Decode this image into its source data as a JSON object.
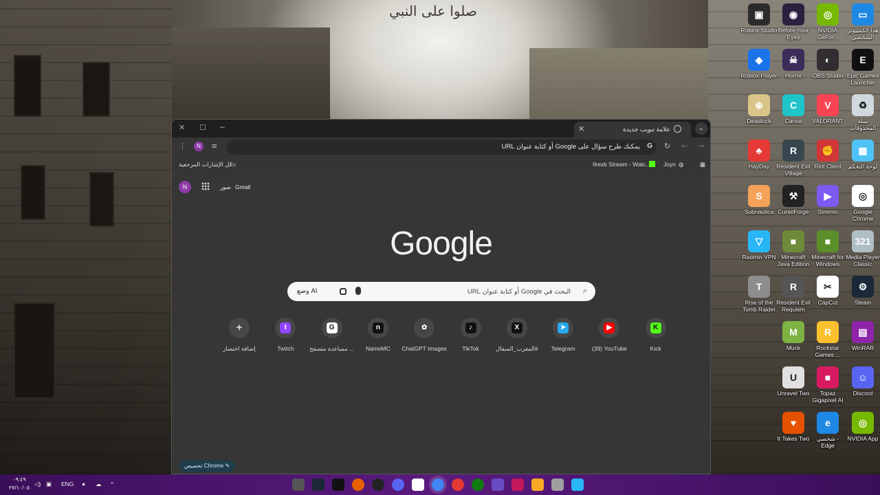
{
  "wallpaper": {
    "title": "صلوا على النبي"
  },
  "desktop_icons": [
    {
      "label": "Roblox Studio",
      "color": "#2b2b2b",
      "glyph": "▣"
    },
    {
      "label": "Before Your Eyes",
      "color": "#2a2140",
      "glyph": "◉"
    },
    {
      "label": "NVIDIA GeFor...",
      "color": "#76b900",
      "glyph": "◎"
    },
    {
      "label": "هذا الكمبيوتر الشخصي",
      "color": "#1e88e5",
      "glyph": "▭"
    },
    {
      "label": "Roblox Player",
      "color": "#1a73e8",
      "glyph": "◆"
    },
    {
      "label": "Horror",
      "color": "#3b2c5a",
      "glyph": "☠"
    },
    {
      "label": "OBS Studio",
      "color": "#302e31",
      "glyph": "◐"
    },
    {
      "label": "Epic Games Launcher",
      "color": "#111111",
      "glyph": "E"
    },
    {
      "label": "Deadlock",
      "color": "#d9c58a",
      "glyph": "⊕"
    },
    {
      "label": "Canva",
      "color": "#20c4cb",
      "glyph": "C"
    },
    {
      "label": "VALORANT",
      "color": "#fa4454",
      "glyph": "V"
    },
    {
      "label": "سلة المحذوفات",
      "color": "#cfd8dc",
      "glyph": "♻"
    },
    {
      "label": "HayDay",
      "color": "#e53935",
      "glyph": "♣"
    },
    {
      "label": "Resident Evil Village",
      "color": "#37474f",
      "glyph": "R"
    },
    {
      "label": "Riot Client",
      "color": "#d13639",
      "glyph": "✊"
    },
    {
      "label": "لوحة التحكم",
      "color": "#4fc3f7",
      "glyph": "▦"
    },
    {
      "label": "Subnautica",
      "color": "#f4a259",
      "glyph": "S"
    },
    {
      "label": "CurseForge",
      "color": "#222222",
      "glyph": "⚒"
    },
    {
      "label": "Stremio",
      "color": "#7b5bf2",
      "glyph": "▶"
    },
    {
      "label": "Google Chrome",
      "color": "#ffffff",
      "glyph": "◎"
    },
    {
      "label": "Radmin VPN",
      "color": "#29b6f6",
      "glyph": "▽"
    },
    {
      "label": "Minecraft Java Edition",
      "color": "#6d8b3a",
      "glyph": "■"
    },
    {
      "label": "Minecraft for Windows",
      "color": "#5a8f29",
      "glyph": "■"
    },
    {
      "label": "Media Player Classic",
      "color": "#b0bec5",
      "glyph": "321"
    },
    {
      "label": "Rise of the Tomb Raider",
      "color": "#8d8d8d",
      "glyph": "T"
    },
    {
      "label": "Resident Evil Requiem",
      "color": "#555555",
      "glyph": "R"
    },
    {
      "label": "CapCut",
      "color": "#ffffff",
      "glyph": "✂"
    },
    {
      "label": "Steam",
      "color": "#1b2838",
      "glyph": "⚙"
    },
    {
      "label": "Muck",
      "color": "#7cb342",
      "glyph": "M"
    },
    {
      "label": "Rockstar Games ...",
      "color": "#fbc02d",
      "glyph": "R"
    },
    {
      "label": "WinRAR",
      "color": "#8e24aa",
      "glyph": "▤"
    },
    {
      "label": "Unravel Two",
      "color": "#e0e0e0",
      "glyph": "U"
    },
    {
      "label": "Topaz Gigapixel AI",
      "color": "#d81b60",
      "glyph": "■"
    },
    {
      "label": "Discord",
      "color": "#5865f2",
      "glyph": "☺"
    },
    {
      "label": "It Takes Two",
      "color": "#e65100",
      "glyph": "♥"
    },
    {
      "label": "شخصي - Edge",
      "color": "#1e88e5",
      "glyph": "e"
    },
    {
      "label": "NVIDIA App",
      "color": "#76b900",
      "glyph": "◎"
    }
  ],
  "chrome": {
    "tab_title": "علامة تبويب جديدة",
    "omnibox_placeholder": "يمكنك طرح سؤال على Google أو كتابة عنوان URL",
    "omnibox_g": "G",
    "avatar_initial": "N",
    "bookmarks": {
      "all_bookmarks": "كل الإشارات المرجعية",
      "item1": "Joyn",
      "item2": "Ilrexb Stream - Watc..."
    },
    "page": {
      "gmail": "Gmail",
      "images": "صور",
      "logo": "Google",
      "search_placeholder": "البحث في Google أو كتابة عنوان URL",
      "ai_mode": "وضع AI",
      "customize": "تخصيص Chrome",
      "shortcuts": [
        {
          "label": "إضافة اختصار",
          "glyph": "+",
          "color": "#474747"
        },
        {
          "label": "Twitch",
          "glyph": "t",
          "color": "#9146ff"
        },
        {
          "label": "مساعدة متصفح ...",
          "glyph": "G",
          "color": "#ffffff"
        },
        {
          "label": "NameMC",
          "glyph": "n",
          "color": "#111111"
        },
        {
          "label": "ChatGPT Images",
          "glyph": "✿",
          "color": "#444444"
        },
        {
          "label": "TikTok",
          "glyph": "♪",
          "color": "#111111"
        },
        {
          "label": "المغرب_السفال#",
          "glyph": "X",
          "color": "#111111"
        },
        {
          "label": "Telegram",
          "glyph": "➤",
          "color": "#29a9eb"
        },
        {
          "label": "(39) YouTube",
          "glyph": "▶",
          "color": "#ff0000"
        },
        {
          "label": "Kick",
          "glyph": "K",
          "color": "#53fc18"
        }
      ]
    }
  },
  "taskbar": {
    "clock_time": "٠٩:٤٩",
    "clock_date": "٢٧/١٠/٠٥",
    "lang": "ENG"
  }
}
